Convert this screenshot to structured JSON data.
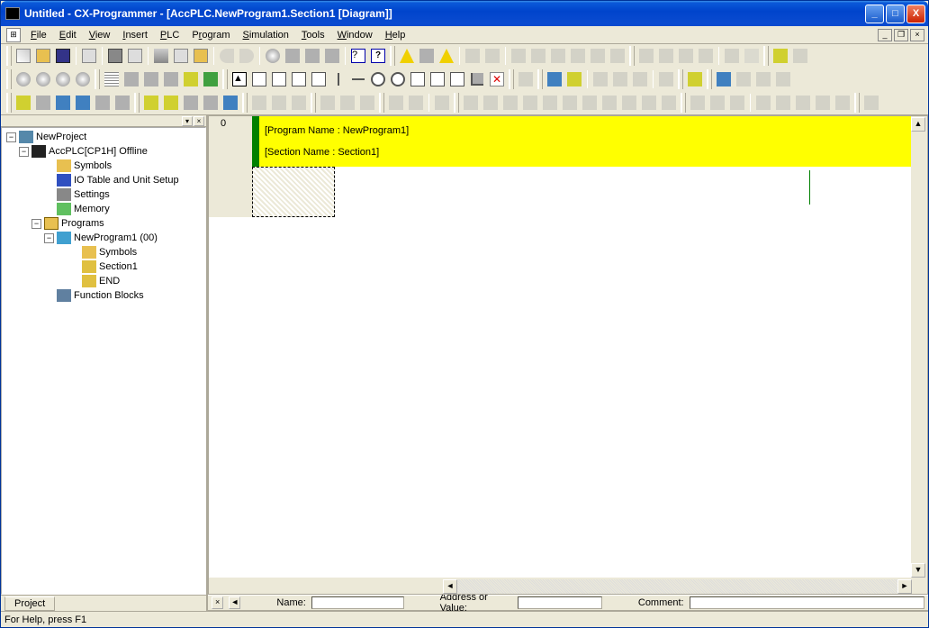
{
  "title": "Untitled - CX-Programmer - [AccPLC.NewProgram1.Section1 [Diagram]]",
  "menu": [
    "File",
    "Edit",
    "View",
    "Insert",
    "PLC",
    "Program",
    "Simulation",
    "Tools",
    "Window",
    "Help"
  ],
  "tree": {
    "root": "NewProject",
    "plc": "AccPLC[CP1H] Offline",
    "items": {
      "symbols": "Symbols",
      "io": "IO Table and Unit Setup",
      "settings": "Settings",
      "memory": "Memory",
      "programs": "Programs",
      "newprogram": "NewProgram1 (00)",
      "np_symbols": "Symbols",
      "section1": "Section1",
      "end": "END",
      "fb": "Function Blocks"
    }
  },
  "sidebar_tab": "Project",
  "ladder": {
    "rung_no": "0",
    "program_name_line": "[Program Name : NewProgram1]",
    "section_name_line": "[Section Name : Section1]"
  },
  "bottom_bar": {
    "name_label": "Name:",
    "addr_label": "Address or Value:",
    "comment_label": "Comment:"
  },
  "status": "For Help, press F1"
}
